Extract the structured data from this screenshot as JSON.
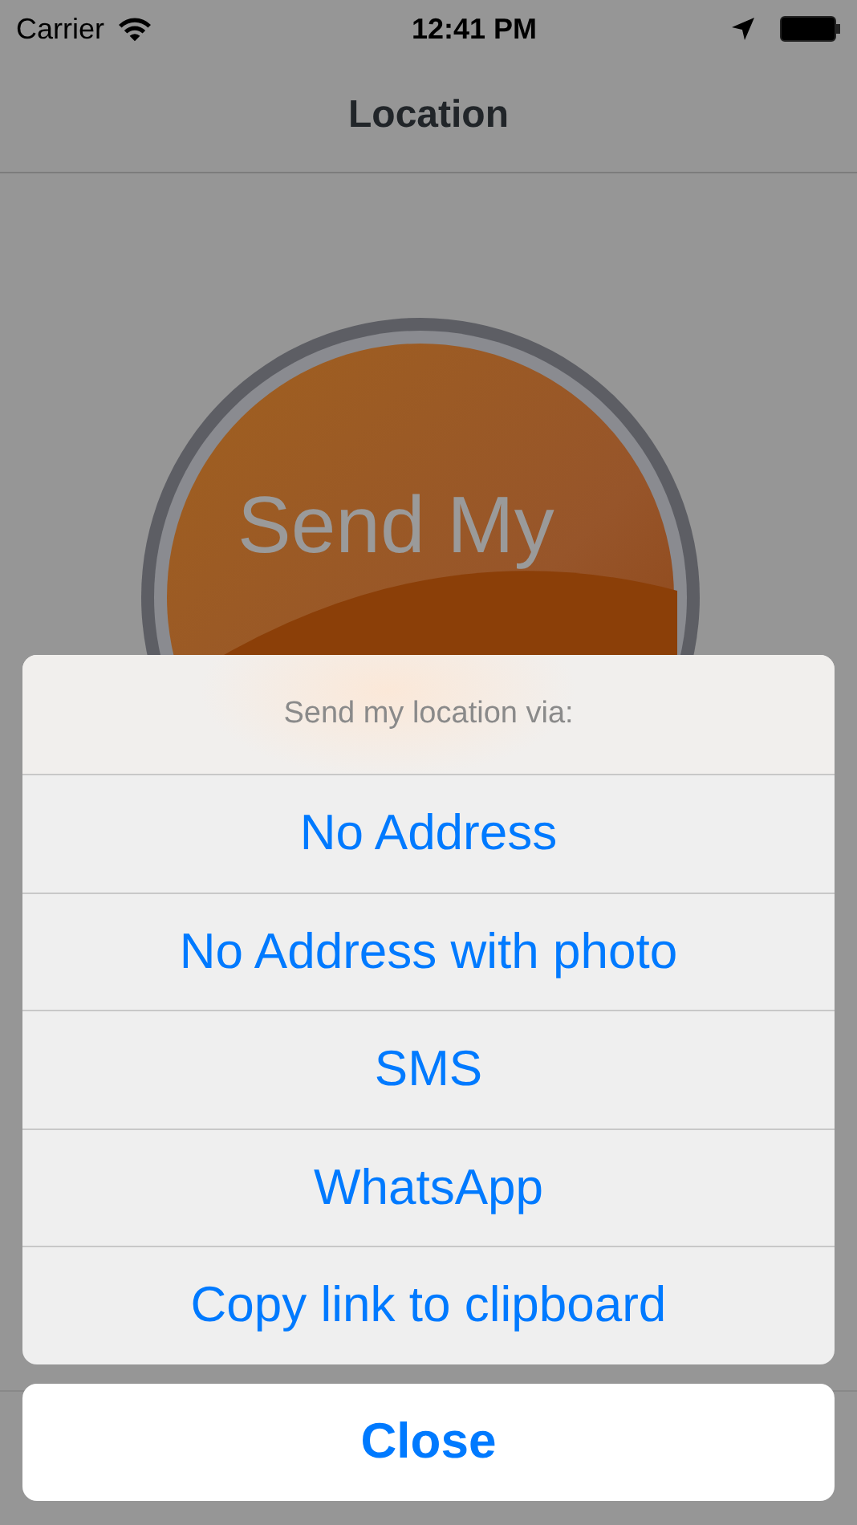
{
  "status_bar": {
    "carrier": "Carrier",
    "time": "12:41 PM"
  },
  "nav_bar": {
    "title": "Location"
  },
  "main_button": {
    "label": "Send My"
  },
  "action_sheet": {
    "title": "Send my location via:",
    "options": [
      "No Address",
      "No Address with photo",
      "SMS",
      "WhatsApp",
      "Copy link to clipboard"
    ],
    "cancel": "Close"
  }
}
